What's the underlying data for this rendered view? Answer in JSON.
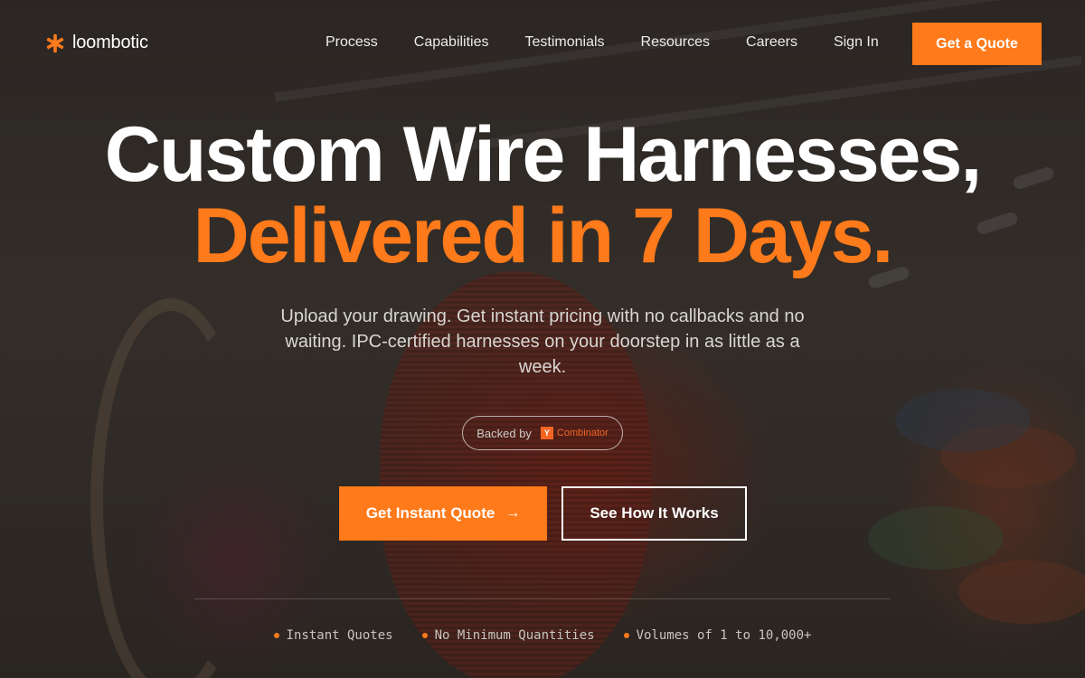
{
  "brand": {
    "name": "loombotic",
    "accent": "#ff7a1a"
  },
  "nav": {
    "links": [
      "Process",
      "Capabilities",
      "Testimonials",
      "Resources",
      "Careers",
      "Sign In"
    ],
    "cta": "Get a Quote"
  },
  "hero": {
    "title_line1": "Custom Wire Harnesses,",
    "title_line2": "Delivered in 7 Days.",
    "subtitle": "Upload your drawing. Get instant pricing with no callbacks and no waiting. IPC-certified harnesses on your doorstep in as little as a week.",
    "backed_label": "Backed by",
    "backer_mark": "Y",
    "backer_name": "Combinator",
    "primary_cta": "Get Instant Quote",
    "secondary_cta": "See How It Works"
  },
  "features": [
    "Instant Quotes",
    "No Minimum Quantities",
    "Volumes of 1 to 10,000+"
  ],
  "icons": {
    "logo": "asterisk-logo-icon",
    "cta_arrow": "arrow-right-icon"
  }
}
